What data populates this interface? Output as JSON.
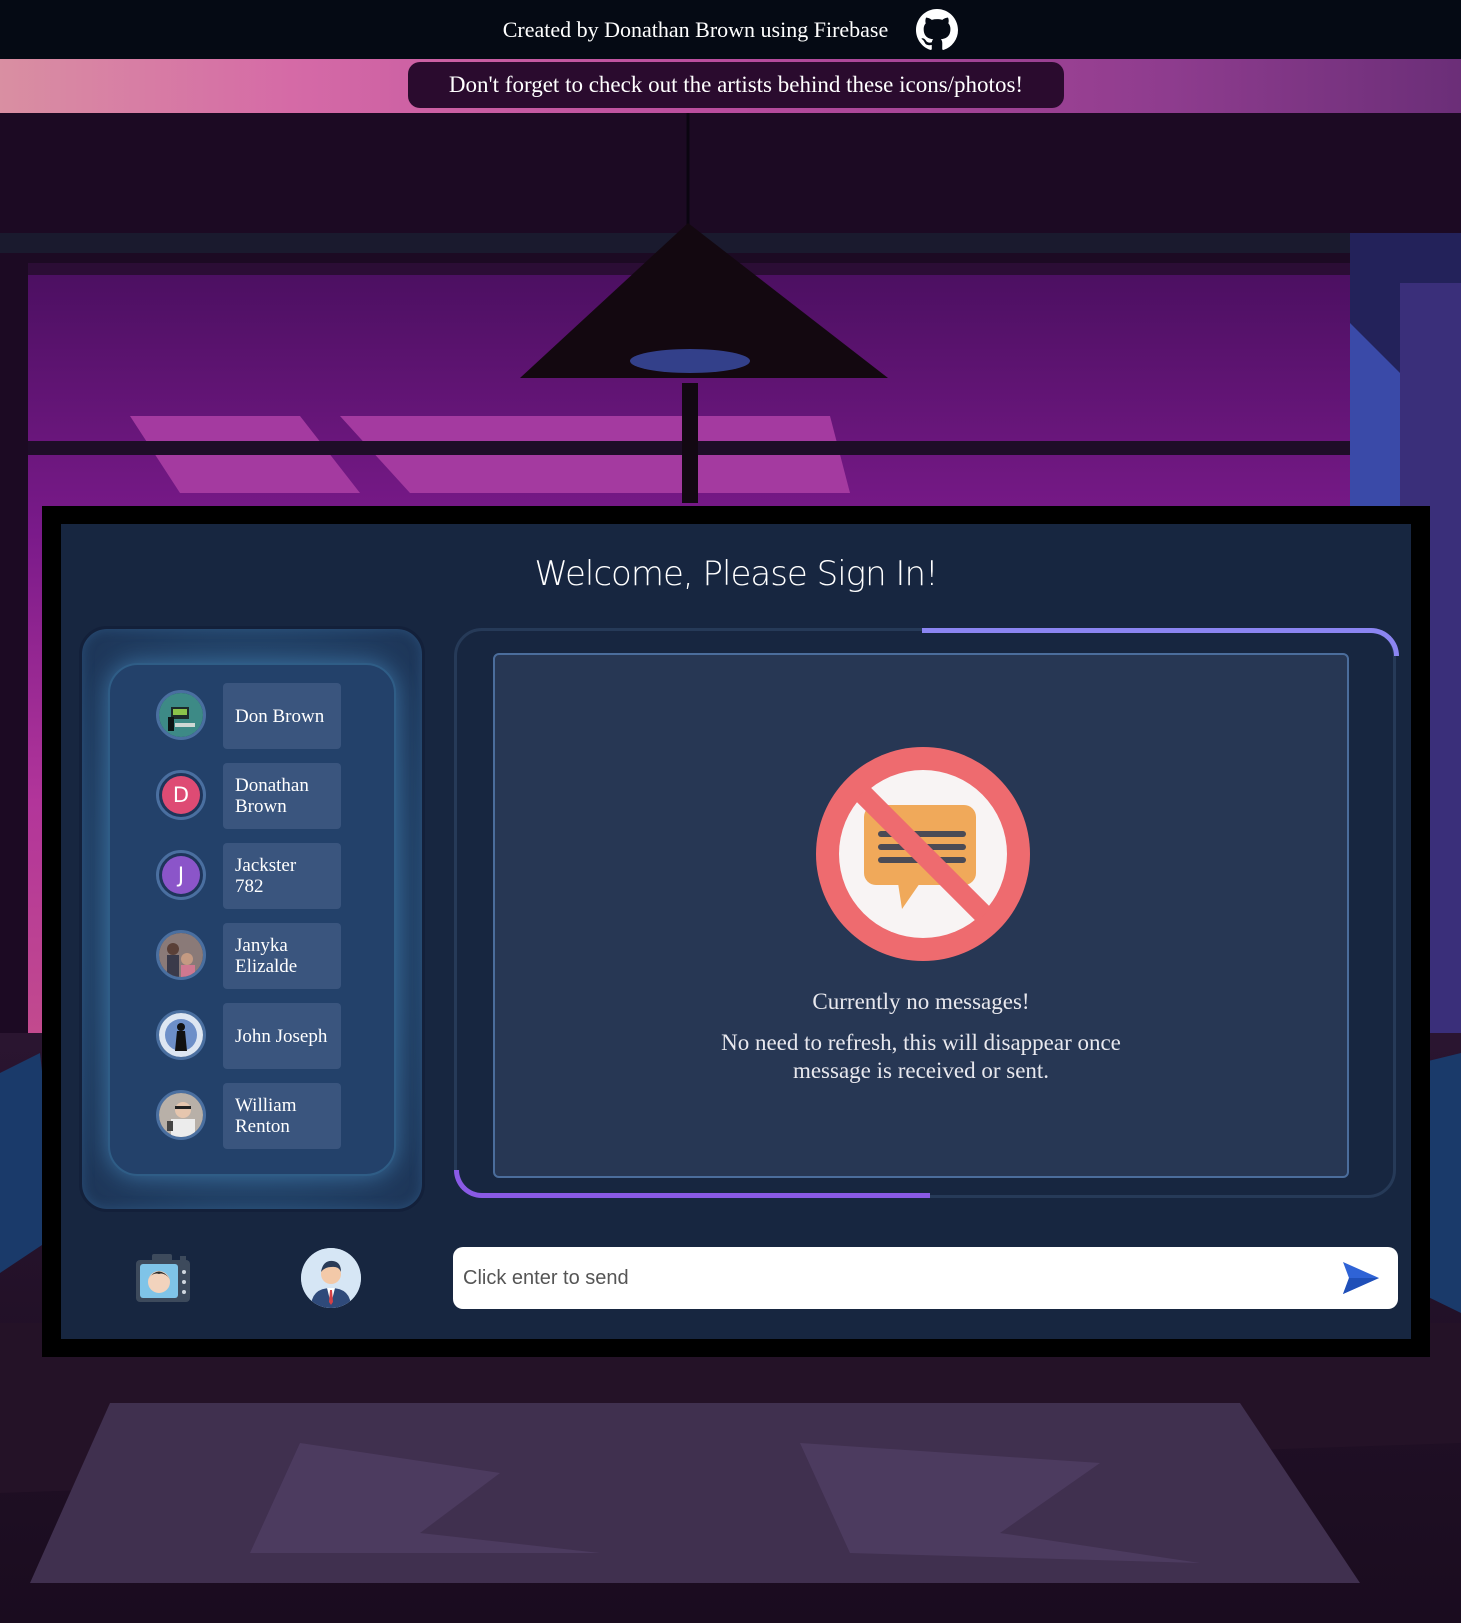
{
  "header": {
    "credit": "Created by Donathan Brown using Firebase",
    "github_icon": "github-icon"
  },
  "banner": {
    "text": "Don't forget to check out the artists behind these icons/photos!"
  },
  "app": {
    "title": "Welcome, Please Sign In!"
  },
  "contacts": [
    {
      "name": "Don Brown",
      "avatar": "photo"
    },
    {
      "name": "Donathan Brown",
      "avatar": "D",
      "color": "#de4b74"
    },
    {
      "name": "Jackster 782",
      "avatar": "J",
      "color": "#8b55c9"
    },
    {
      "name": "Janyka Elizalde",
      "avatar": "photo"
    },
    {
      "name": "John Joseph",
      "avatar": "photo"
    },
    {
      "name": "William Renton",
      "avatar": "photo"
    }
  ],
  "chat": {
    "empty_title": "Currently no messages!",
    "empty_subtitle": "No need to refresh, this will disappear once message is received or sent.",
    "empty_icon": "no-messages-icon"
  },
  "composer": {
    "placeholder": "Click enter to send",
    "camera_icon": "camera-icon",
    "profile_icon": "profile-avatar-icon",
    "send_icon": "send-icon"
  }
}
